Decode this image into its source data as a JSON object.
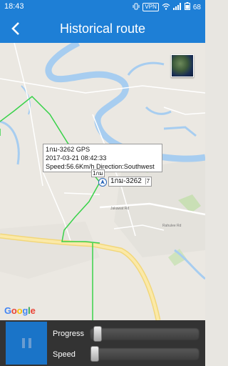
{
  "status_bar": {
    "time": "18:43",
    "vpn": "VPN",
    "battery": "68"
  },
  "header": {
    "title": "Historical route"
  },
  "map": {
    "popup": {
      "line1": "1กม-3262 GPS",
      "line2": "2017-03-21 08:42:33",
      "line3": "Speed:56.6Km/h  Direction:Southwest"
    },
    "plate_label": "1กม-3262",
    "plate_label_suffix": "7",
    "plate_label_small": "1กม",
    "road_labels": {
      "road1": "Jakawat Rd",
      "road2": "Rahulee Rd"
    },
    "attribution": "Google",
    "attribution_letters": [
      "G",
      "o",
      "o",
      "g",
      "l",
      "e"
    ],
    "attribution_colors": [
      "#4285F4",
      "#EA4335",
      "#FBBC05",
      "#4285F4",
      "#34A853",
      "#EA4335"
    ]
  },
  "playback": {
    "progress_label": "Progress",
    "speed_label": "Speed",
    "progress_value": 0.03,
    "speed_value": 0.0
  }
}
